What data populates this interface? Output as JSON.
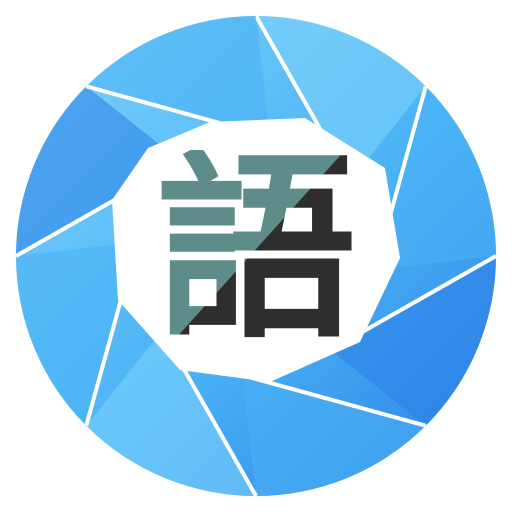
{
  "logo": {
    "glyph": "語",
    "colors": {
      "ring_light": "#7fd3fb",
      "ring_mid": "#4ab2f5",
      "ring_dark": "#2b7fe6",
      "blade_line": "#ffffff",
      "glyph_teal": "#5d8c8a",
      "glyph_dark": "#2e2e2e",
      "background": "#ffffff"
    },
    "icon": "camera-aperture-icon"
  }
}
